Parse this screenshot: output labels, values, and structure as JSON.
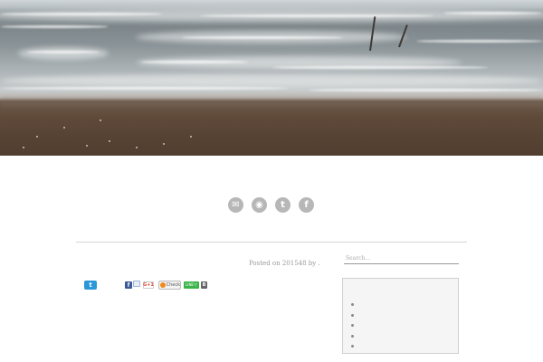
{
  "hero": {
    "image": "beach-waves-photo"
  },
  "social": [
    {
      "icon": "mail-icon",
      "glyph": "✉"
    },
    {
      "icon": "rss-icon",
      "glyph": "◉"
    },
    {
      "icon": "twitter-icon",
      "glyph": "t"
    },
    {
      "icon": "facebook-icon",
      "glyph": "f"
    }
  ],
  "post": {
    "posted_prefix": "Posted on ",
    "date": "201548",
    "by": " by ."
  },
  "search": {
    "placeholder": "Search..."
  },
  "share": {
    "twitter_glyph": "t",
    "facebook_glyph": "f",
    "googleplus": "G+1",
    "check": "Check",
    "line": "LINEで",
    "hatena": "B"
  },
  "sidebar": {
    "widget_items": [
      "",
      "",
      "",
      "",
      ""
    ]
  },
  "colors": {
    "icon_gray": "#b7b7b7",
    "twitter_blue": "#2a97d8",
    "facebook_blue": "#3b5998",
    "line_green": "#3bb34a"
  }
}
